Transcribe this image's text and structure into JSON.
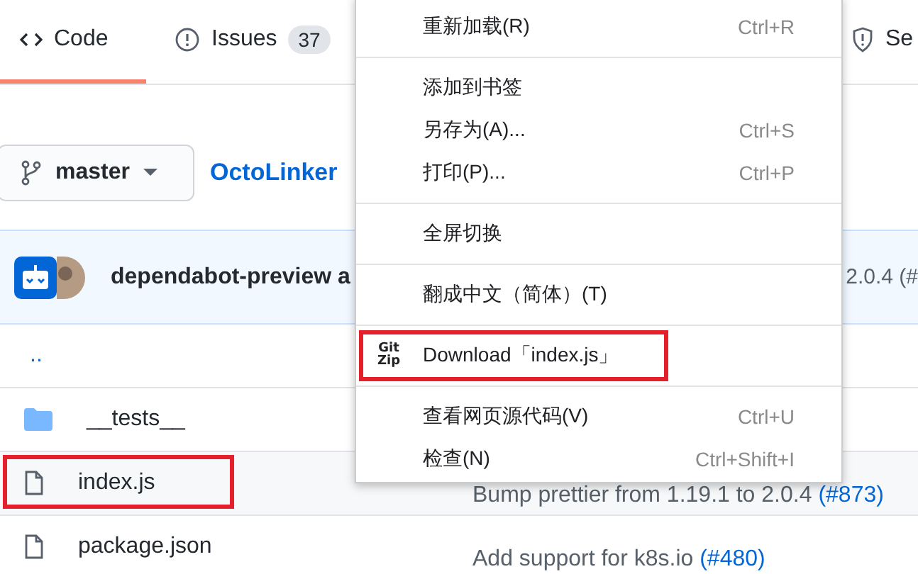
{
  "tabs": [
    {
      "kind": "code",
      "label": "Code",
      "selected": true
    },
    {
      "kind": "issues",
      "label": "Issues",
      "counter": "37",
      "selected": false
    },
    {
      "kind": "security",
      "label": "Se",
      "selected": false
    }
  ],
  "branch": {
    "name": "master"
  },
  "repo_link": "OctoLinker",
  "latest_commit": {
    "author": "dependabot-preview a",
    "message_end": "2.0.4 (#"
  },
  "files": [
    {
      "kind": "parent",
      "name": "..",
      "hovered": false,
      "highlighted": false
    },
    {
      "kind": "folder",
      "name": "__tests__",
      "hovered": false,
      "highlighted": false
    },
    {
      "kind": "file",
      "name": "index.js",
      "message": "Bump prettier from 1.19.1 to 2.0.4",
      "link": "(#873)",
      "hovered": true,
      "highlighted": true
    },
    {
      "kind": "file",
      "name": "package.json",
      "message": "Add support for k8s.io",
      "link": "(#480)",
      "hovered": false,
      "highlighted": false
    }
  ],
  "context_menu": {
    "groups": [
      {
        "items": [
          {
            "label": "重新加载(R)",
            "shortcut": "Ctrl+R",
            "highlighted": false
          }
        ]
      },
      {
        "items": [
          {
            "label": "添加到书签",
            "highlighted": false
          },
          {
            "label": "另存为(A)...",
            "shortcut": "Ctrl+S",
            "highlighted": false
          },
          {
            "label": "打印(P)...",
            "shortcut": "Ctrl+P",
            "highlighted": false
          }
        ]
      },
      {
        "items": [
          {
            "label": "全屏切换",
            "highlighted": false
          }
        ]
      },
      {
        "items": [
          {
            "label": "翻成中文（简体）(T)",
            "highlighted": false
          }
        ]
      },
      {
        "items": [
          {
            "label": "Download「index.js」",
            "icon_text": "Git Zip",
            "highlighted": true
          }
        ]
      },
      {
        "items": [
          {
            "label": "查看网页源代码(V)",
            "shortcut": "Ctrl+U",
            "highlighted": false
          },
          {
            "label": "检查(N)",
            "shortcut": "Ctrl+Shift+I",
            "highlighted": false
          }
        ]
      }
    ]
  }
}
